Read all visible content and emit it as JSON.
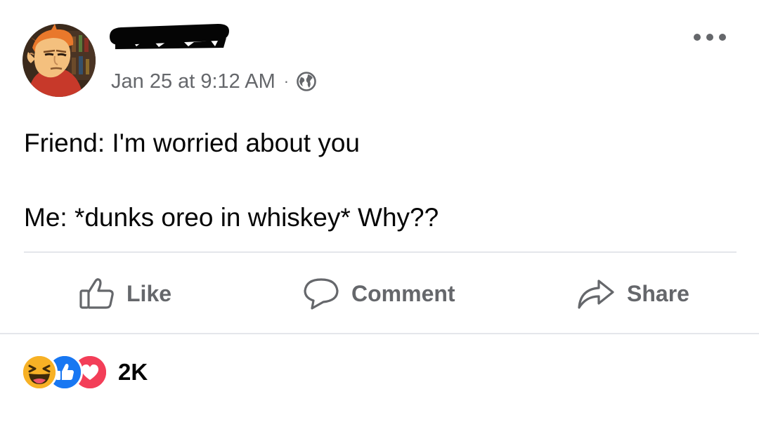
{
  "post": {
    "timestamp": "Jan 25 at 9:12 AM",
    "separator": "·",
    "privacy_icon": "globe-icon",
    "more_icon": "more-options-icon",
    "body": {
      "line1": "Friend: I'm worried about you",
      "line2": "Me: *dunks oreo in whiskey* Why??"
    }
  },
  "actions": {
    "like_label": "Like",
    "comment_label": "Comment",
    "share_label": "Share"
  },
  "reactions": {
    "types": [
      "haha",
      "like",
      "love"
    ],
    "count": "2K"
  },
  "colors": {
    "text_primary": "#050505",
    "text_secondary": "#65676b",
    "divider": "#e4e6eb",
    "like_blue": "#1877f2",
    "love_red": "#f33e58",
    "haha_yellow": "#f7b125"
  }
}
